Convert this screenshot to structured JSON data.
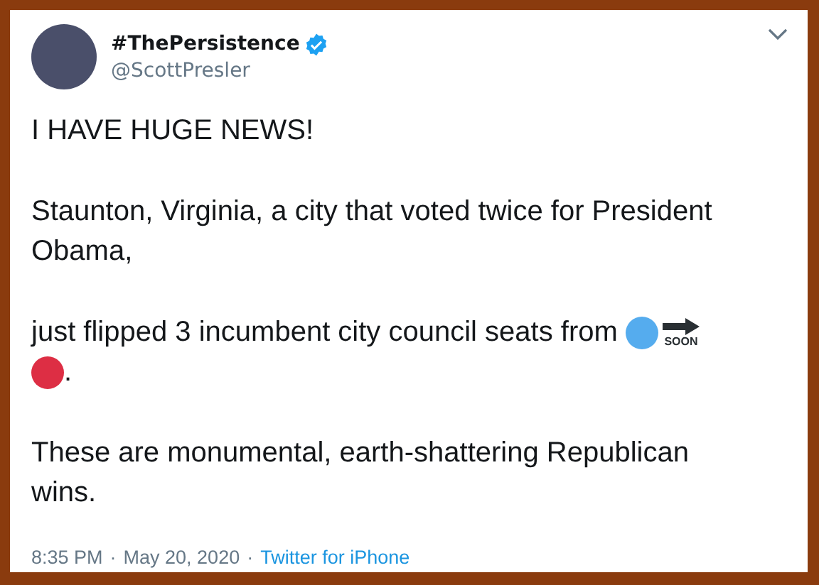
{
  "tweet": {
    "display_name": "#ThePersistence",
    "verified": true,
    "handle": "@ScottPresler",
    "paragraphs": [
      {
        "lines": [
          [
            {
              "kind": "text",
              "text": "I HAVE HUGE NEWS!"
            }
          ]
        ]
      },
      {
        "lines": [
          [
            {
              "kind": "text",
              "text": "Staunton, Virginia, a city that voted twice for President"
            }
          ],
          [
            {
              "kind": "text",
              "text": "Obama,"
            }
          ]
        ]
      },
      {
        "lines": [
          [
            {
              "kind": "text",
              "text": "just flipped 3 incumbent city council seats from "
            },
            {
              "kind": "dot",
              "color": "#55acee"
            },
            {
              "kind": "soon",
              "text": "SOON"
            }
          ],
          [
            {
              "kind": "dot",
              "color": "#dd2e44"
            },
            {
              "kind": "text",
              "text": "."
            }
          ]
        ]
      },
      {
        "lines": [
          [
            {
              "kind": "text",
              "text": "These are monumental, earth-shattering Republican"
            }
          ],
          [
            {
              "kind": "text",
              "text": "wins."
            }
          ]
        ]
      }
    ],
    "time": "8:35 PM",
    "separator": "·",
    "date": "May 20, 2020",
    "source": "Twitter for iPhone"
  }
}
